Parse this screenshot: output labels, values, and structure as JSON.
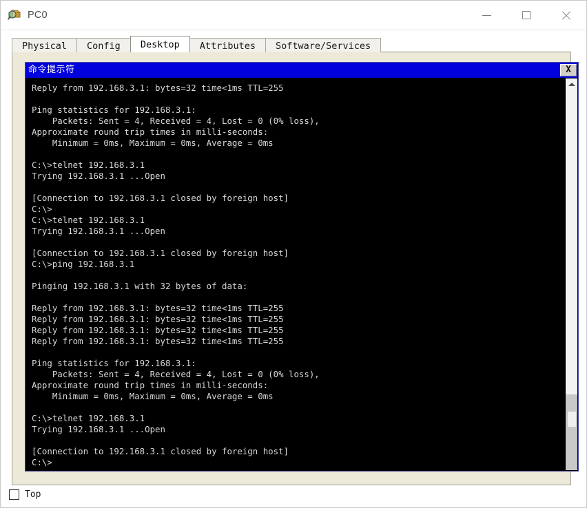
{
  "window": {
    "title": "PC0",
    "icon": "packet-tracer-device-icon",
    "controls": {
      "minimize_label": "—",
      "maximize_label": "□",
      "close_label": "✕"
    }
  },
  "tabs": [
    {
      "label": "Physical",
      "active": false
    },
    {
      "label": "Config",
      "active": false
    },
    {
      "label": "Desktop",
      "active": true
    },
    {
      "label": "Attributes",
      "active": false
    },
    {
      "label": "Software/Services",
      "active": false
    }
  ],
  "command_prompt": {
    "title": "命令提示符",
    "close_label": "X",
    "colors": {
      "titlebar_bg": "#0000dd",
      "titlebar_fg": "#ffffff",
      "terminal_bg": "#000000",
      "terminal_fg": "#d8d8d8"
    },
    "terminal_text": "Reply from 192.168.3.1: bytes=32 time<1ms TTL=255\n\nPing statistics for 192.168.3.1:\n    Packets: Sent = 4, Received = 4, Lost = 0 (0% loss),\nApproximate round trip times in milli-seconds:\n    Minimum = 0ms, Maximum = 0ms, Average = 0ms\n\nC:\\>telnet 192.168.3.1\nTrying 192.168.3.1 ...Open\n\n[Connection to 192.168.3.1 closed by foreign host]\nC:\\>\nC:\\>telnet 192.168.3.1\nTrying 192.168.3.1 ...Open\n\n[Connection to 192.168.3.1 closed by foreign host]\nC:\\>ping 192.168.3.1\n\nPinging 192.168.3.1 with 32 bytes of data:\n\nReply from 192.168.3.1: bytes=32 time<1ms TTL=255\nReply from 192.168.3.1: bytes=32 time<1ms TTL=255\nReply from 192.168.3.1: bytes=32 time<1ms TTL=255\nReply from 192.168.3.1: bytes=32 time<1ms TTL=255\n\nPing statistics for 192.168.3.1:\n    Packets: Sent = 4, Received = 4, Lost = 0 (0% loss),\nApproximate round trip times in milli-seconds:\n    Minimum = 0ms, Maximum = 0ms, Average = 0ms\n\nC:\\>telnet 192.168.3.1\nTrying 192.168.3.1 ...Open\n\n[Connection to 192.168.3.1 closed by foreign host]\nC:\\>",
    "scrollbar": {
      "up_arrow": "▲",
      "down_arrow": "▼"
    }
  },
  "footer": {
    "top_checkbox_label": "Top",
    "top_checkbox_checked": false
  }
}
